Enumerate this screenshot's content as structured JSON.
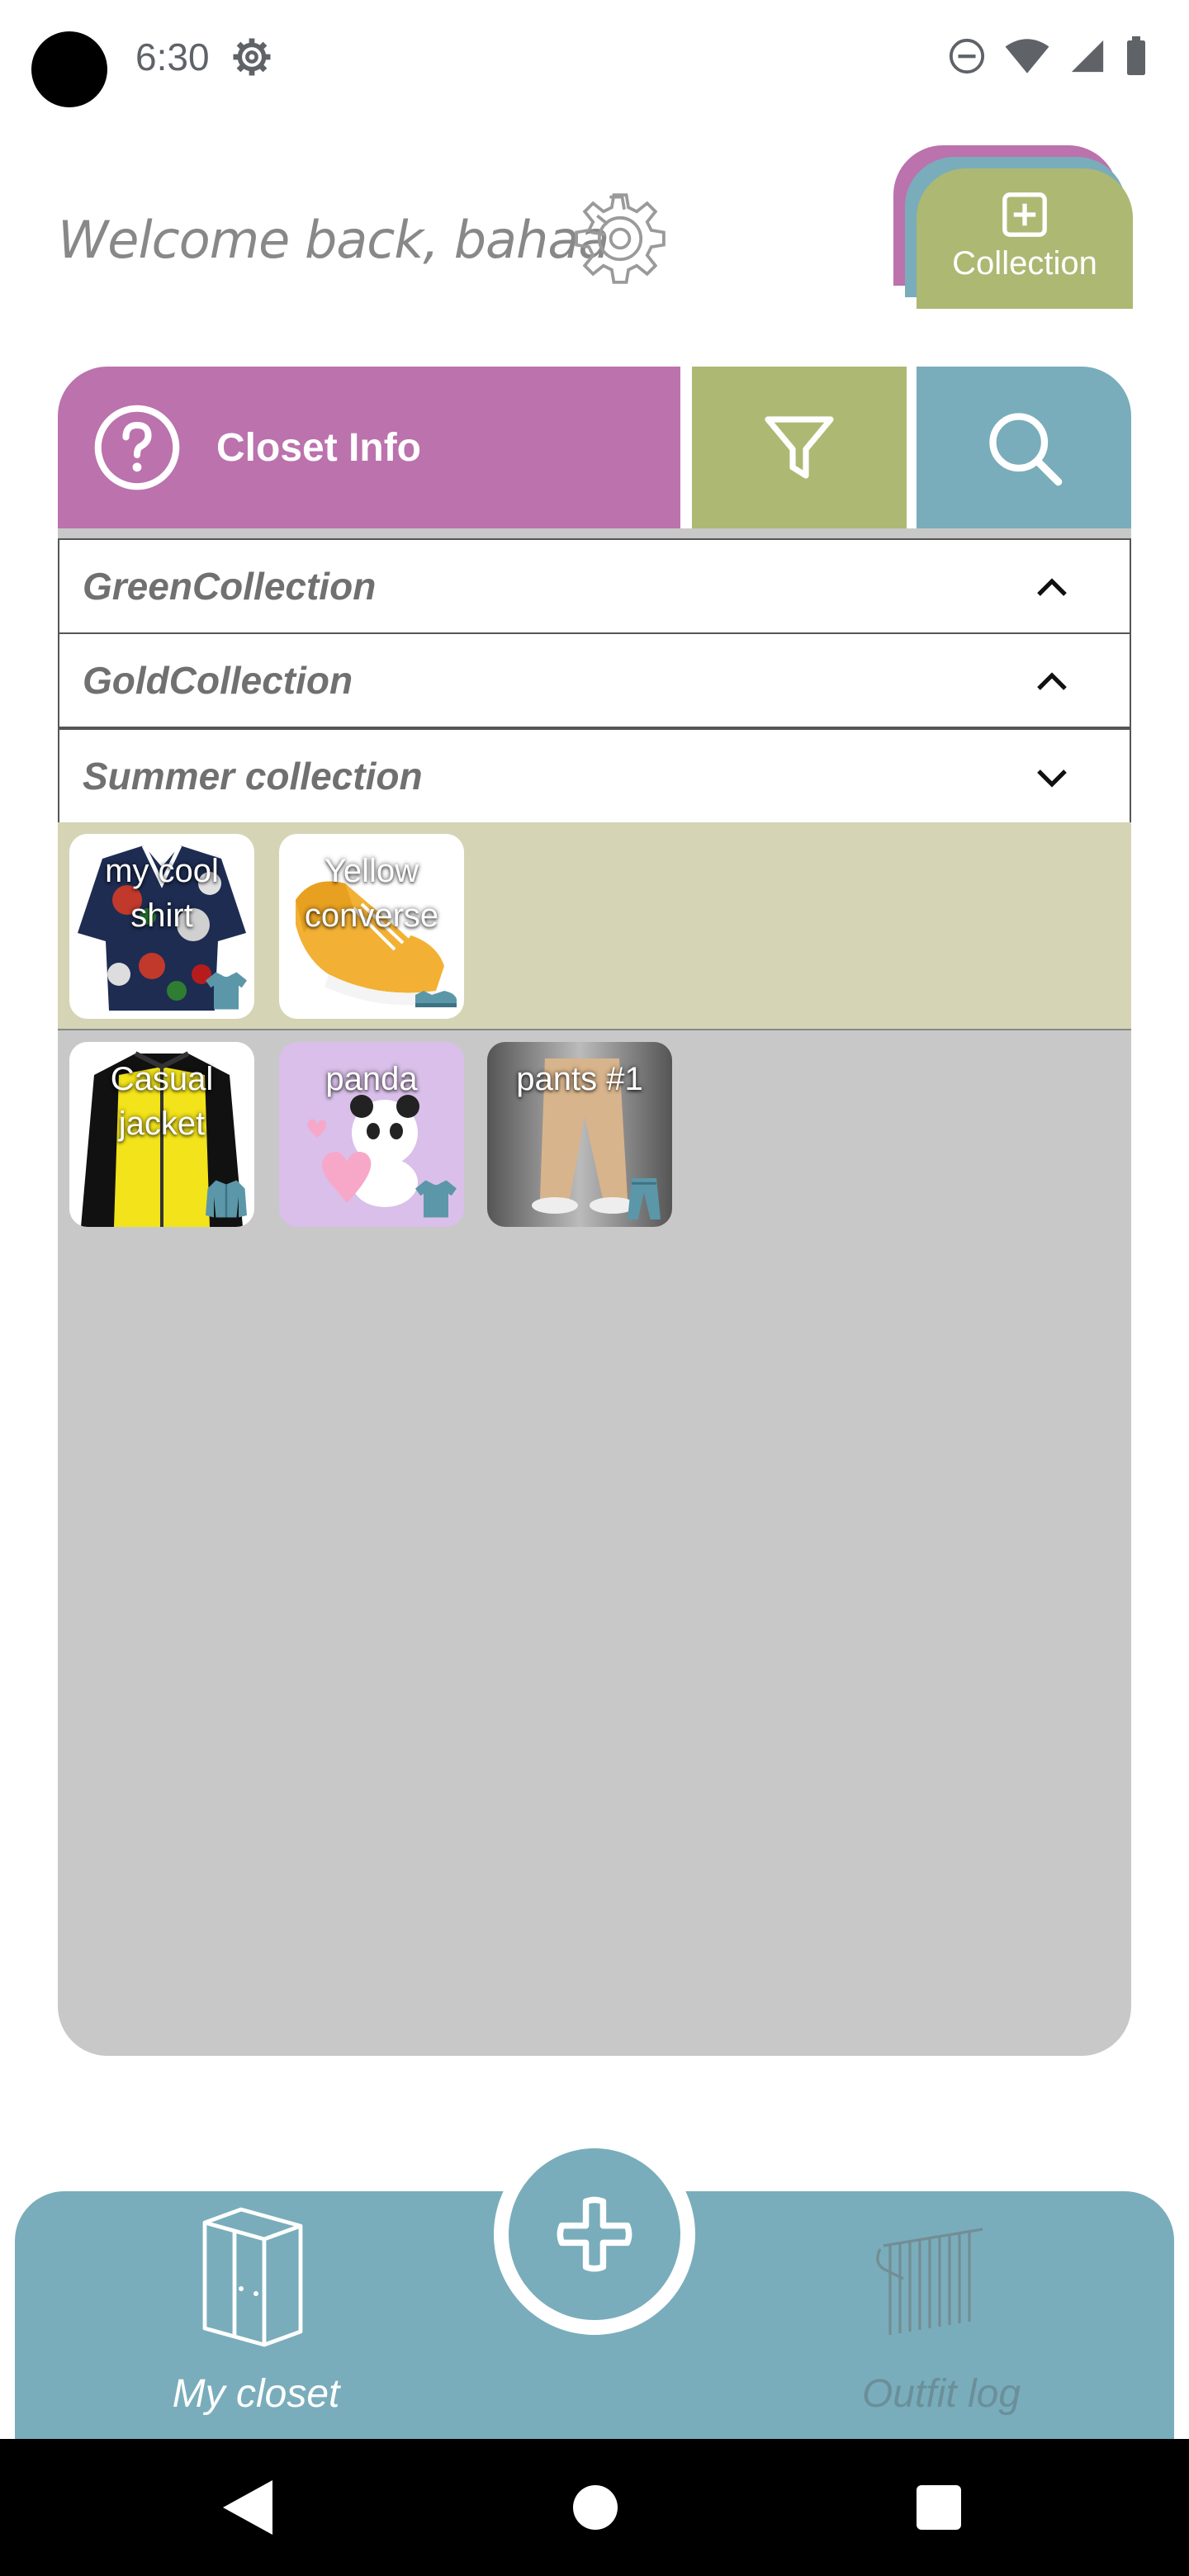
{
  "status_bar": {
    "time": "6:30"
  },
  "header": {
    "welcome": "Welcome back, bahaa"
  },
  "collection_button": {
    "label": "Collection"
  },
  "toolbar": {
    "info_label": "Closet Info"
  },
  "collections": [
    {
      "name": "GreenCollection",
      "expanded": false
    },
    {
      "name": "GoldCollection",
      "expanded": false
    },
    {
      "name": "Summer collection",
      "expanded": true
    }
  ],
  "collection_items": [
    {
      "title": "my cool shirt",
      "type": "shirt-icon"
    },
    {
      "title": "Yellow converse",
      "type": "shoe-icon"
    }
  ],
  "closet_items": [
    {
      "title": "Casual jacket",
      "type": "jacket-icon"
    },
    {
      "title": "panda",
      "type": "shirt-icon"
    },
    {
      "title": "pants #1",
      "type": "pants-icon"
    }
  ],
  "bottom_nav": {
    "closet_label": "My closet",
    "outfit_label": "Outfit log"
  },
  "colors": {
    "purple": "#bb72ad",
    "green": "#adb873",
    "teal": "#79adbb",
    "panel_gray": "#c8c8c8"
  }
}
